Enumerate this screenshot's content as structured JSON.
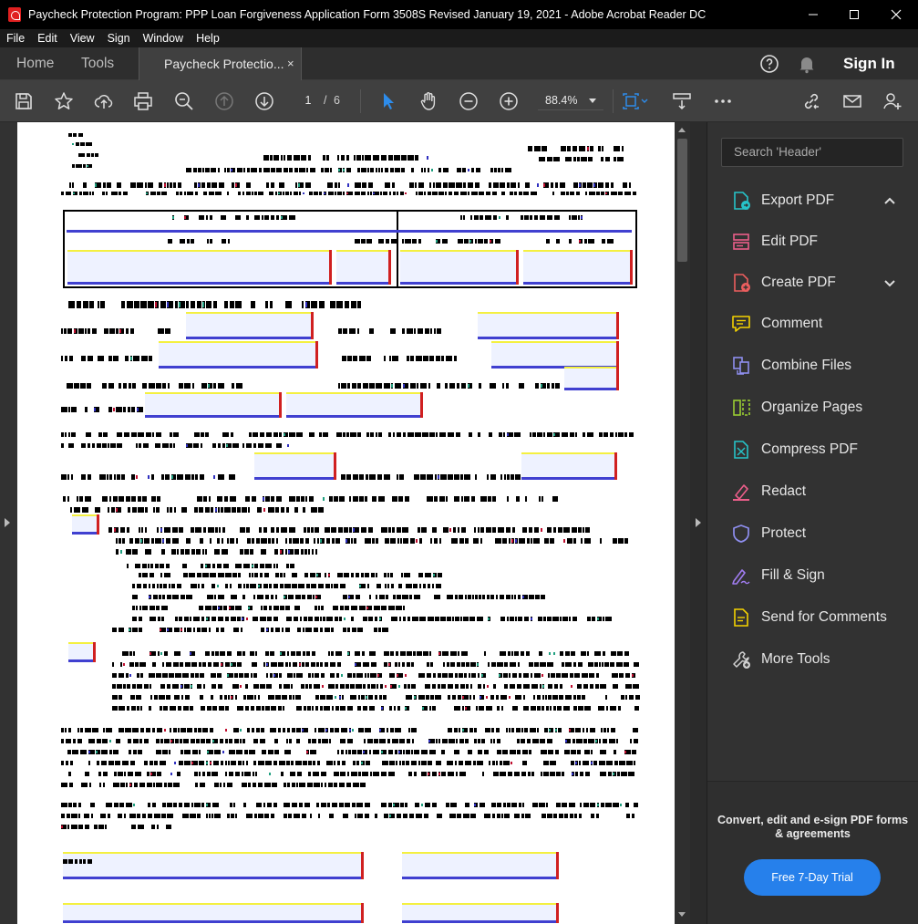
{
  "window": {
    "title": "Paycheck Protection Program: PPP Loan Forgiveness Application Form 3508S Revised January 19, 2021 - Adobe Acrobat Reader DC"
  },
  "menu": [
    "File",
    "Edit",
    "View",
    "Sign",
    "Window",
    "Help"
  ],
  "tabs": {
    "home": "Home",
    "tools": "Tools",
    "document": "Paycheck Protectio...",
    "close": "×",
    "sign_in": "Sign In"
  },
  "toolbar": {
    "page_current": "1",
    "page_sep": "/",
    "page_total": "6",
    "zoom": "88.4%"
  },
  "right_panel": {
    "search_placeholder": "Search 'Header'",
    "tools": [
      {
        "label": "Export PDF",
        "icon": "export-pdf-icon",
        "color": "#26c3c8"
      },
      {
        "label": "Edit PDF",
        "icon": "edit-pdf-icon",
        "color": "#ec5e8a"
      },
      {
        "label": "Create PDF",
        "icon": "create-pdf-icon",
        "color": "#ec5e5e"
      },
      {
        "label": "Comment",
        "icon": "comment-icon",
        "color": "#f4d200"
      },
      {
        "label": "Combine Files",
        "icon": "combine-files-icon",
        "color": "#8f8ff0"
      },
      {
        "label": "Organize Pages",
        "icon": "organize-pages-icon",
        "color": "#9acd32"
      },
      {
        "label": "Compress PDF",
        "icon": "compress-pdf-icon",
        "color": "#26c3c8"
      },
      {
        "label": "Redact",
        "icon": "redact-icon",
        "color": "#ec5e8a"
      },
      {
        "label": "Protect",
        "icon": "protect-icon",
        "color": "#8f8ff0"
      },
      {
        "label": "Fill & Sign",
        "icon": "fill-sign-icon",
        "color": "#a07cf0"
      },
      {
        "label": "Send for Comments",
        "icon": "send-comments-icon",
        "color": "#f4d200"
      },
      {
        "label": "More Tools",
        "icon": "more-tools-icon",
        "color": "#d0d0d0"
      }
    ],
    "promo_text": "Convert, edit and e-sign PDF forms & agreements",
    "promo_button": "Free 7-Day Trial"
  },
  "colors": {
    "accent": "#2680eb",
    "selection_tool": "#2d8ceb"
  }
}
